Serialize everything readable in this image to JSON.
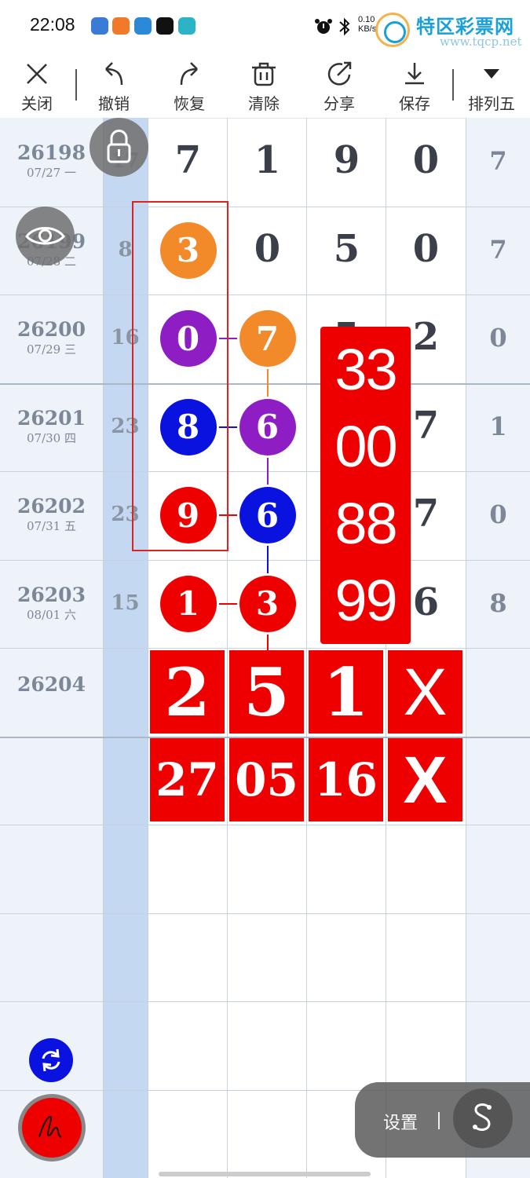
{
  "status_bar": {
    "time": "22:08",
    "net_speed": "0.10",
    "net_unit": "KB/s",
    "watermark_text": "特区彩票网",
    "watermark_url": "www.tqcp.net"
  },
  "toolbar": {
    "close": "关闭",
    "undo": "撤销",
    "redo": "恢复",
    "clear": "清除",
    "share": "分享",
    "save": "保存",
    "mode": "排列五"
  },
  "rows": [
    {
      "issue": "26198",
      "date": "07/27 一",
      "miss": "17",
      "digits": [
        "7",
        "1",
        "9",
        "0"
      ],
      "sum": "7"
    },
    {
      "issue": "26199",
      "date": "07/28 二",
      "miss": "8",
      "digits": [
        "3",
        "0",
        "5",
        "0"
      ],
      "sum": "7"
    },
    {
      "issue": "26200",
      "date": "07/29 三",
      "miss": "16",
      "digits": [
        "0",
        "7",
        "5",
        "2"
      ],
      "sum": "0"
    },
    {
      "issue": "26201",
      "date": "07/30 四",
      "miss": "23",
      "digits": [
        "8",
        "6",
        "",
        "7"
      ],
      "sum": "1"
    },
    {
      "issue": "26202",
      "date": "07/31 五",
      "miss": "23",
      "digits": [
        "9",
        "6",
        "",
        "7"
      ],
      "sum": "0"
    },
    {
      "issue": "26203",
      "date": "08/01 六",
      "miss": "15",
      "digits": [
        "1",
        "3",
        "",
        "6"
      ],
      "sum": "8"
    },
    {
      "issue": "26204",
      "date": "",
      "miss": "",
      "digits": [
        "",
        "",
        "",
        ""
      ],
      "sum": ""
    }
  ],
  "balls": [
    {
      "row": 1,
      "col": 0,
      "value": "3",
      "color": "#f28a2a"
    },
    {
      "row": 2,
      "col": 0,
      "value": "0",
      "color": "#8e1ec4"
    },
    {
      "row": 2,
      "col": 1,
      "value": "7",
      "color": "#f28a2a"
    },
    {
      "row": 3,
      "col": 0,
      "value": "8",
      "color": "#0a12e0"
    },
    {
      "row": 3,
      "col": 1,
      "value": "6",
      "color": "#8e1ec4"
    },
    {
      "row": 4,
      "col": 0,
      "value": "9",
      "color": "#ee0000"
    },
    {
      "row": 4,
      "col": 1,
      "value": "6",
      "color": "#0a12e0"
    },
    {
      "row": 5,
      "col": 0,
      "value": "1",
      "color": "#ee0000"
    },
    {
      "row": 5,
      "col": 1,
      "value": "3",
      "color": "#ee0000"
    }
  ],
  "big_red_numbers": [
    "33",
    "00",
    "88",
    "99"
  ],
  "prediction_row1": [
    "2",
    "5",
    "1",
    "X"
  ],
  "prediction_row2": [
    "27",
    "05",
    "16",
    "X"
  ],
  "settings": {
    "label": "设置",
    "separator": "|"
  },
  "colors": {
    "accent_red": "#ee0000",
    "orange": "#f28a2a",
    "purple": "#8e1ec4",
    "blue": "#0a12e0",
    "highlight_col": "#c5d8f2",
    "side_col": "#eef3fa"
  }
}
